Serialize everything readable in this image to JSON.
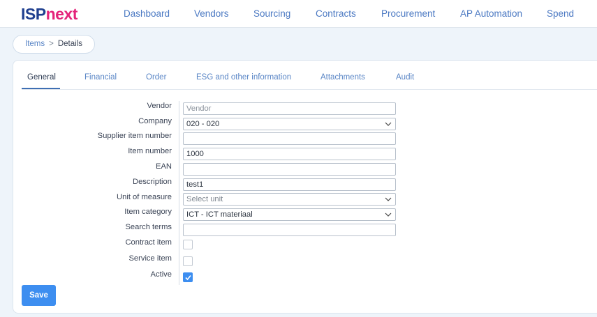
{
  "brand": {
    "part1": "ISP",
    "part2": "next"
  },
  "nav": {
    "items": [
      "Dashboard",
      "Vendors",
      "Sourcing",
      "Contracts",
      "Procurement",
      "AP Automation",
      "Spend"
    ]
  },
  "breadcrumb": {
    "link": "Items",
    "separator": ">",
    "current": "Details"
  },
  "tabs": [
    "General",
    "Financial",
    "Order",
    "ESG and other information",
    "Attachments",
    "Audit"
  ],
  "form": {
    "vendor": {
      "label": "Vendor",
      "placeholder": "Vendor",
      "value": ""
    },
    "company": {
      "label": "Company",
      "value": "020 - 020"
    },
    "supplier_item_number": {
      "label": "Supplier item number",
      "value": ""
    },
    "item_number": {
      "label": "Item number",
      "value": "1000"
    },
    "ean": {
      "label": "EAN",
      "value": ""
    },
    "description": {
      "label": "Description",
      "value": "test1"
    },
    "unit_of_measure": {
      "label": "Unit of measure",
      "placeholder": "Select unit"
    },
    "item_category": {
      "label": "Item category",
      "value": "ICT - ICT materiaal"
    },
    "search_terms": {
      "label": "Search terms",
      "value": ""
    },
    "contract_item": {
      "label": "Contract item",
      "checked": false
    },
    "service_item": {
      "label": "Service item",
      "checked": false
    },
    "active": {
      "label": "Active",
      "checked": true
    }
  },
  "save_label": "Save",
  "icons": {
    "dropdown": "chevron-down-icon",
    "check": "check-icon"
  },
  "colors": {
    "brand_blue": "#1f3f8f",
    "brand_pink": "#e4247b",
    "accent": "#3d8ef0",
    "nav_link": "#4a78c2"
  }
}
